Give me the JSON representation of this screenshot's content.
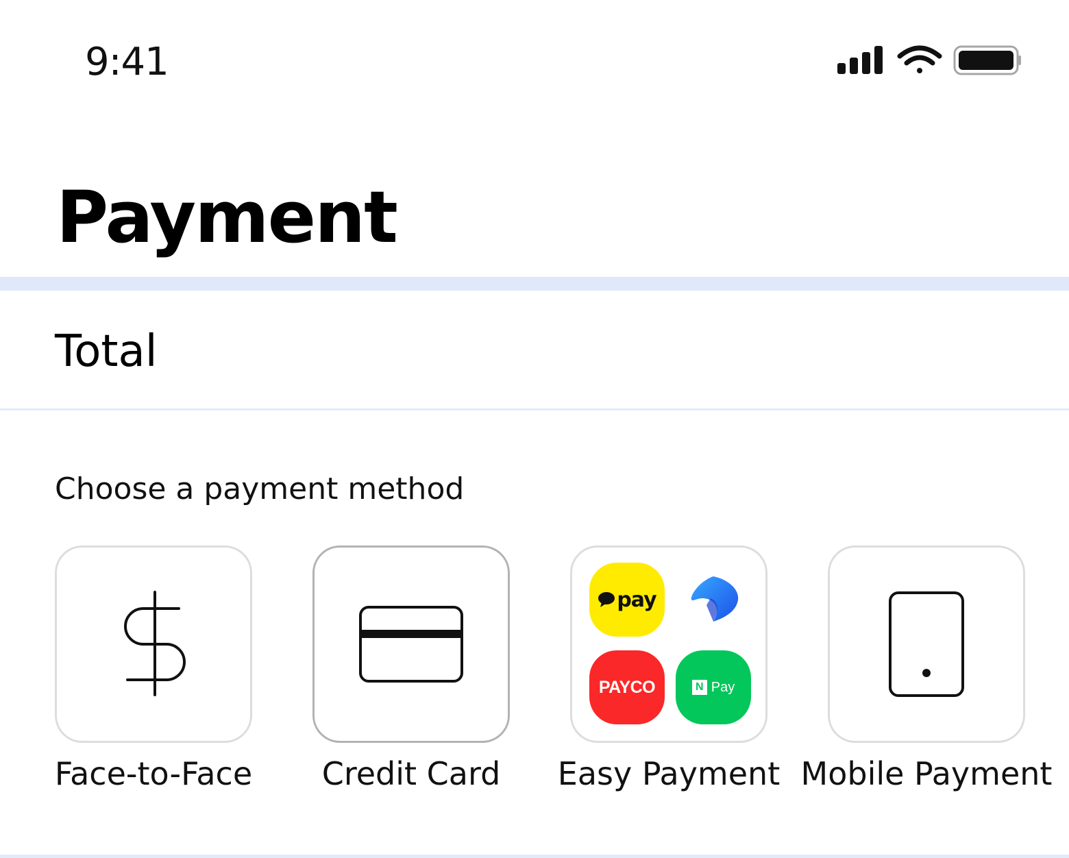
{
  "status_bar": {
    "time": "9:41",
    "icons": [
      "cellular-signal-icon",
      "wifi-icon",
      "battery-icon"
    ]
  },
  "header": {
    "title": "Payment"
  },
  "summary": {
    "total_label": "Total"
  },
  "payment": {
    "section_label": "Choose a payment method",
    "selected": "Credit Card",
    "methods": [
      {
        "label": "Face-to-Face",
        "icon": "dollar-sign-icon"
      },
      {
        "label": "Credit Card",
        "icon": "credit-card-icon"
      },
      {
        "label": "Easy Payment",
        "icon": "easy-pay-logos"
      },
      {
        "label": "Mobile Payment",
        "icon": "mobile-phone-icon"
      }
    ],
    "easy_pay_logos": {
      "kakao": "pay",
      "payco": "PAYCO",
      "npay_badge": "N",
      "npay": "Pay"
    }
  },
  "colors": {
    "accent_band": "#dfe9fb",
    "kakao_yellow": "#ffeb00",
    "payco_red": "#fa2828",
    "npay_green": "#03c75a",
    "toss_blue": "#1b64f2"
  }
}
